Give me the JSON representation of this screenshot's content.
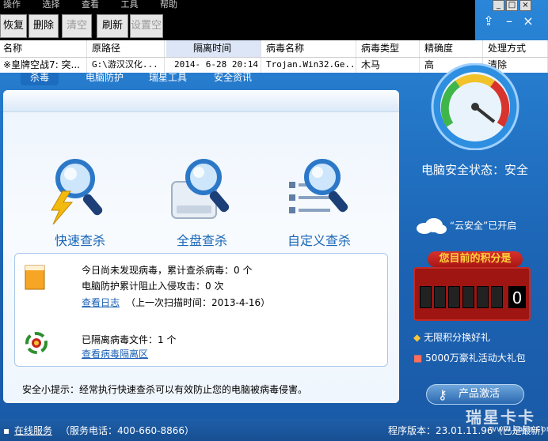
{
  "menu": [
    "操作",
    "选择",
    "查看",
    "工具",
    "帮助"
  ],
  "toolbar": {
    "restore": "恢复",
    "delete": "删除",
    "clear": "清空",
    "refresh": "刷新",
    "settings": "设置空间"
  },
  "grid": {
    "headers": [
      "名称",
      "原路径",
      "隔离时间",
      "病毒名称",
      "病毒类型",
      "精确度",
      "处理方式"
    ],
    "rows": [
      [
        "※皇牌空战7: 突...",
        "G:\\游汉汉化...",
        "2014- 6-28 20:14",
        "Trojan.Win32.Ge...",
        "木马",
        "高",
        "清除"
      ]
    ]
  },
  "tabs": [
    "杀毒",
    "电脑防护",
    "瑞星工具",
    "安全资讯"
  ],
  "scan": {
    "quick": "快速查杀",
    "full": "全盘查杀",
    "custom": "自定义查杀"
  },
  "info": {
    "line1": "今日尚未发现病毒，累计查杀病毒：0 个",
    "line2": "电脑防护累计阻止入侵攻击：0 次",
    "view_log": "查看日志",
    "last_scan": "（上一次扫描时间：2013-4-16）",
    "quarantined": "已隔离病毒文件：1 个",
    "view_quarantine": "查看病毒隔离区"
  },
  "tip": "安全小提示：经常执行快速查杀可以有效防止您的电脑被病毒侵害。",
  "right": {
    "security_status": "电脑安全状态：安全",
    "cloud": "“云安全”已开启",
    "points_title": "您目前的积分是",
    "points_value": "0",
    "gift1": "无限积分换好礼",
    "gift2": "5000万豪礼活动大礼包",
    "activate": "产品激活"
  },
  "statusbar": {
    "online": "在线服务",
    "phone": "（服务电话：400-660-8866）",
    "version": "程序版本：23.01.11.96（已是最新）"
  },
  "watermark": {
    "text": "瑞星卡卡",
    "url": "www.kaka.com"
  },
  "colors": {
    "frame": "#1d6fbd",
    "link": "#1a5fb4",
    "scan_label": "#1866b8",
    "points_bg": "#9e1512",
    "points_title": "#ffd23a"
  }
}
